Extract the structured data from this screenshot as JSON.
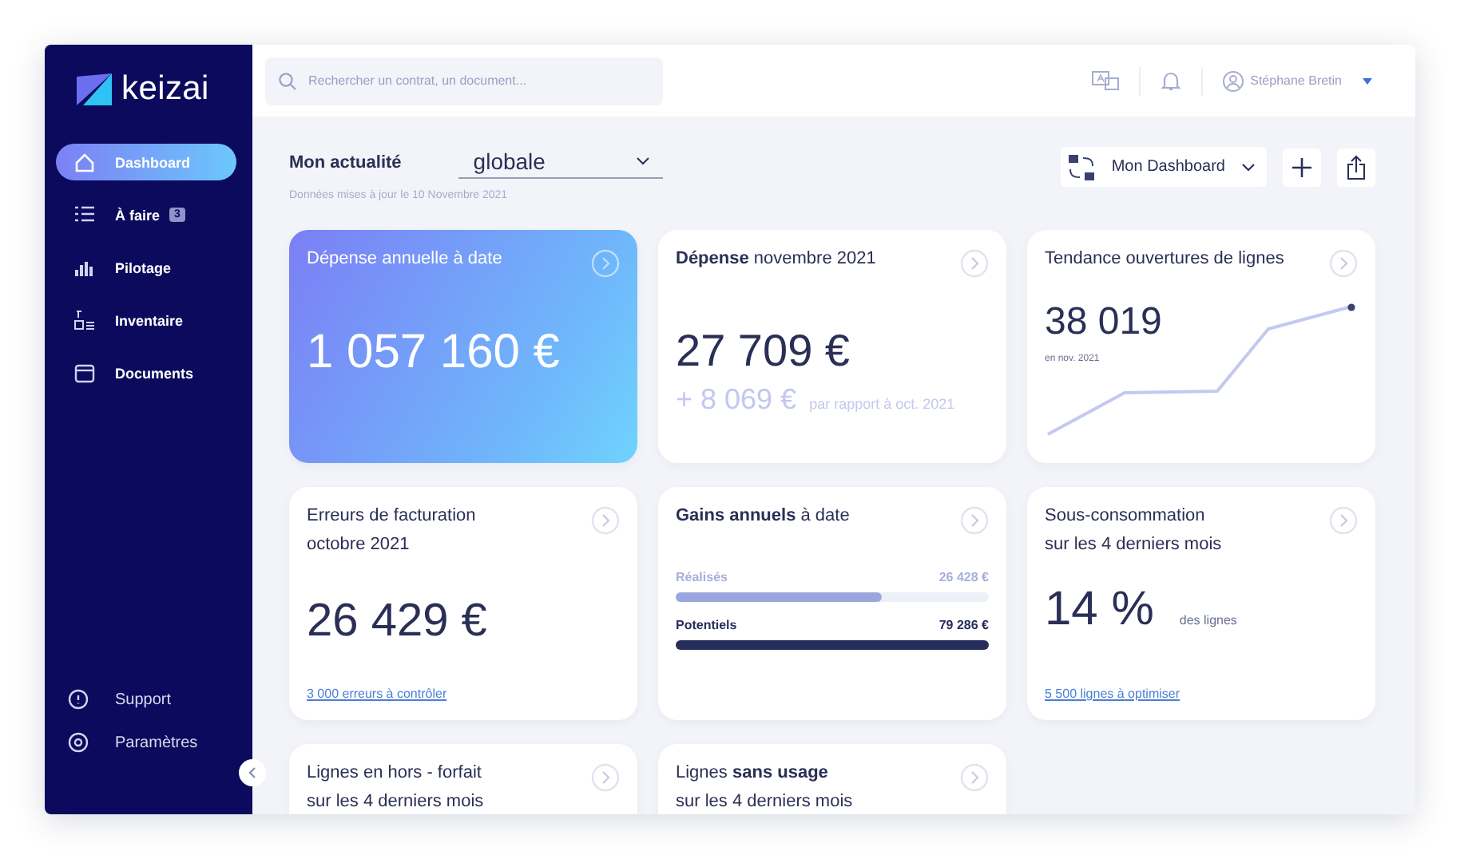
{
  "app": {
    "logo": "keizai"
  },
  "sidebar": {
    "items": [
      {
        "label": "Dashboard",
        "selected": true
      },
      {
        "label": "À faire",
        "badge": "3",
        "selected": false
      },
      {
        "label": "Pilotage",
        "selected": false
      },
      {
        "label": "Inventaire",
        "selected": false
      },
      {
        "label": "Documents",
        "selected": false
      }
    ],
    "footer_items": [
      {
        "label": "Support"
      },
      {
        "label": "Paramètres"
      }
    ]
  },
  "header": {
    "search": {
      "placeholder": "Rechercher un contrat, un document..."
    },
    "user": {
      "name": "Stéphane Bretin"
    }
  },
  "toolbar": {
    "title": "Mon actualité",
    "filter": {
      "value": "globale"
    },
    "updated": "Données mises à jour le 10 Novembre 2021",
    "dashboard": {
      "value": "Mon Dashboard"
    }
  },
  "cards": [
    {
      "kind": "highlight",
      "title": "Dépense annuelle à date",
      "value": "1 057 160 €"
    },
    {
      "kind": "comparison",
      "title": "**Dépense** novembre 2021",
      "value": "27 709 €",
      "delta": "+ 8 069 €",
      "delta_note": "par rapport à oct. 2021"
    },
    {
      "kind": "trend",
      "title": "Tendance ouvertures de lignes",
      "value": "38 019",
      "note": "en nov. 2021"
    },
    {
      "kind": "link",
      "title": "Erreurs de facturation",
      "subtitle": "octobre 2021",
      "value": "26 429 €",
      "link": "3 000 erreurs à contrôler"
    },
    {
      "kind": "progress",
      "title": "**Gains annuels** à date",
      "bars": [
        {
          "label": "Réalisés",
          "amount": "26 428 €",
          "level": 0.66,
          "emphasized": false,
          "color": "#9ba6dc"
        },
        {
          "label": "Potentiels",
          "amount": "79 286 €",
          "level": 1,
          "emphasized": true,
          "color": "#272d5b"
        }
      ]
    },
    {
      "kind": "percent",
      "title": "Sous-consommation",
      "subtitle": "sur les 4 derniers mois",
      "value": "14 %",
      "unit": "des lignes",
      "link": "5 500 lignes à optimiser"
    },
    {
      "kind": "summary",
      "title": "Lignes en hors - forfait",
      "subtitle": "sur les 4 derniers mois"
    },
    {
      "kind": "summary",
      "title": "Lignes **sans usage**",
      "subtitle": "sur les 4 derniers mois"
    }
  ]
}
